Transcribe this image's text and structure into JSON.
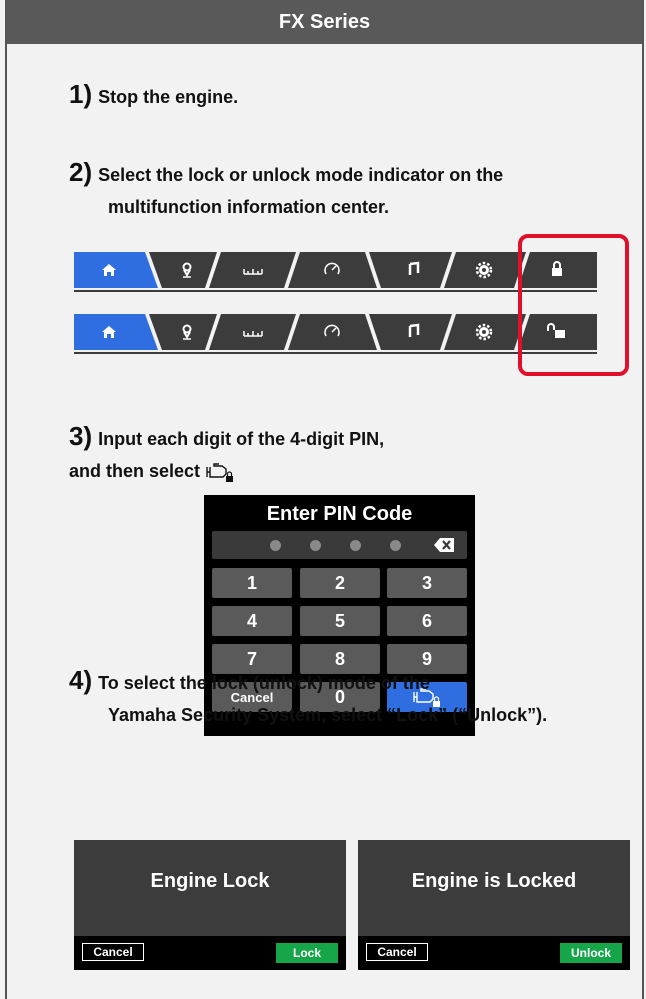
{
  "header": {
    "title": "FX Series"
  },
  "steps": [
    {
      "number": "1)",
      "text": "Stop the engine."
    },
    {
      "number": "2)",
      "line1": "Select the lock or unlock mode indicator on the",
      "line2": "multifunction information center."
    },
    {
      "number": "3)",
      "line1": "Input each digit of the 4-digit PIN,",
      "line2": "and then select"
    },
    {
      "number": "4)",
      "line1": "To select the lock (unlock) mode of the",
      "line2": "Yamaha Security System, select “Lock” (“Unlock”)."
    }
  ],
  "navbar": {
    "icons": [
      "home-icon",
      "location-pin-icon",
      "ruler-icon",
      "gauge-icon",
      "music-icon",
      "gear-icon"
    ],
    "locked_indicator": "lock-closed-icon",
    "unlocked_indicator": "lock-open-icon",
    "active_color": "#2f6ee0",
    "highlight_color": "#e0102a"
  },
  "pin_pad": {
    "title": "Enter PIN Code",
    "digits_entered": 0,
    "digits_total": 4,
    "keys": [
      "1",
      "2",
      "3",
      "4",
      "5",
      "6",
      "7",
      "8",
      "9"
    ],
    "cancel_label": "Cancel",
    "zero_label": "0",
    "confirm_icon": "engine-lock-icon"
  },
  "dialogs": [
    {
      "title": "Engine Lock",
      "cancel_label": "Cancel",
      "action_label": "Lock"
    },
    {
      "title": "Engine is Locked",
      "cancel_label": "Cancel",
      "action_label": "Unlock"
    }
  ]
}
